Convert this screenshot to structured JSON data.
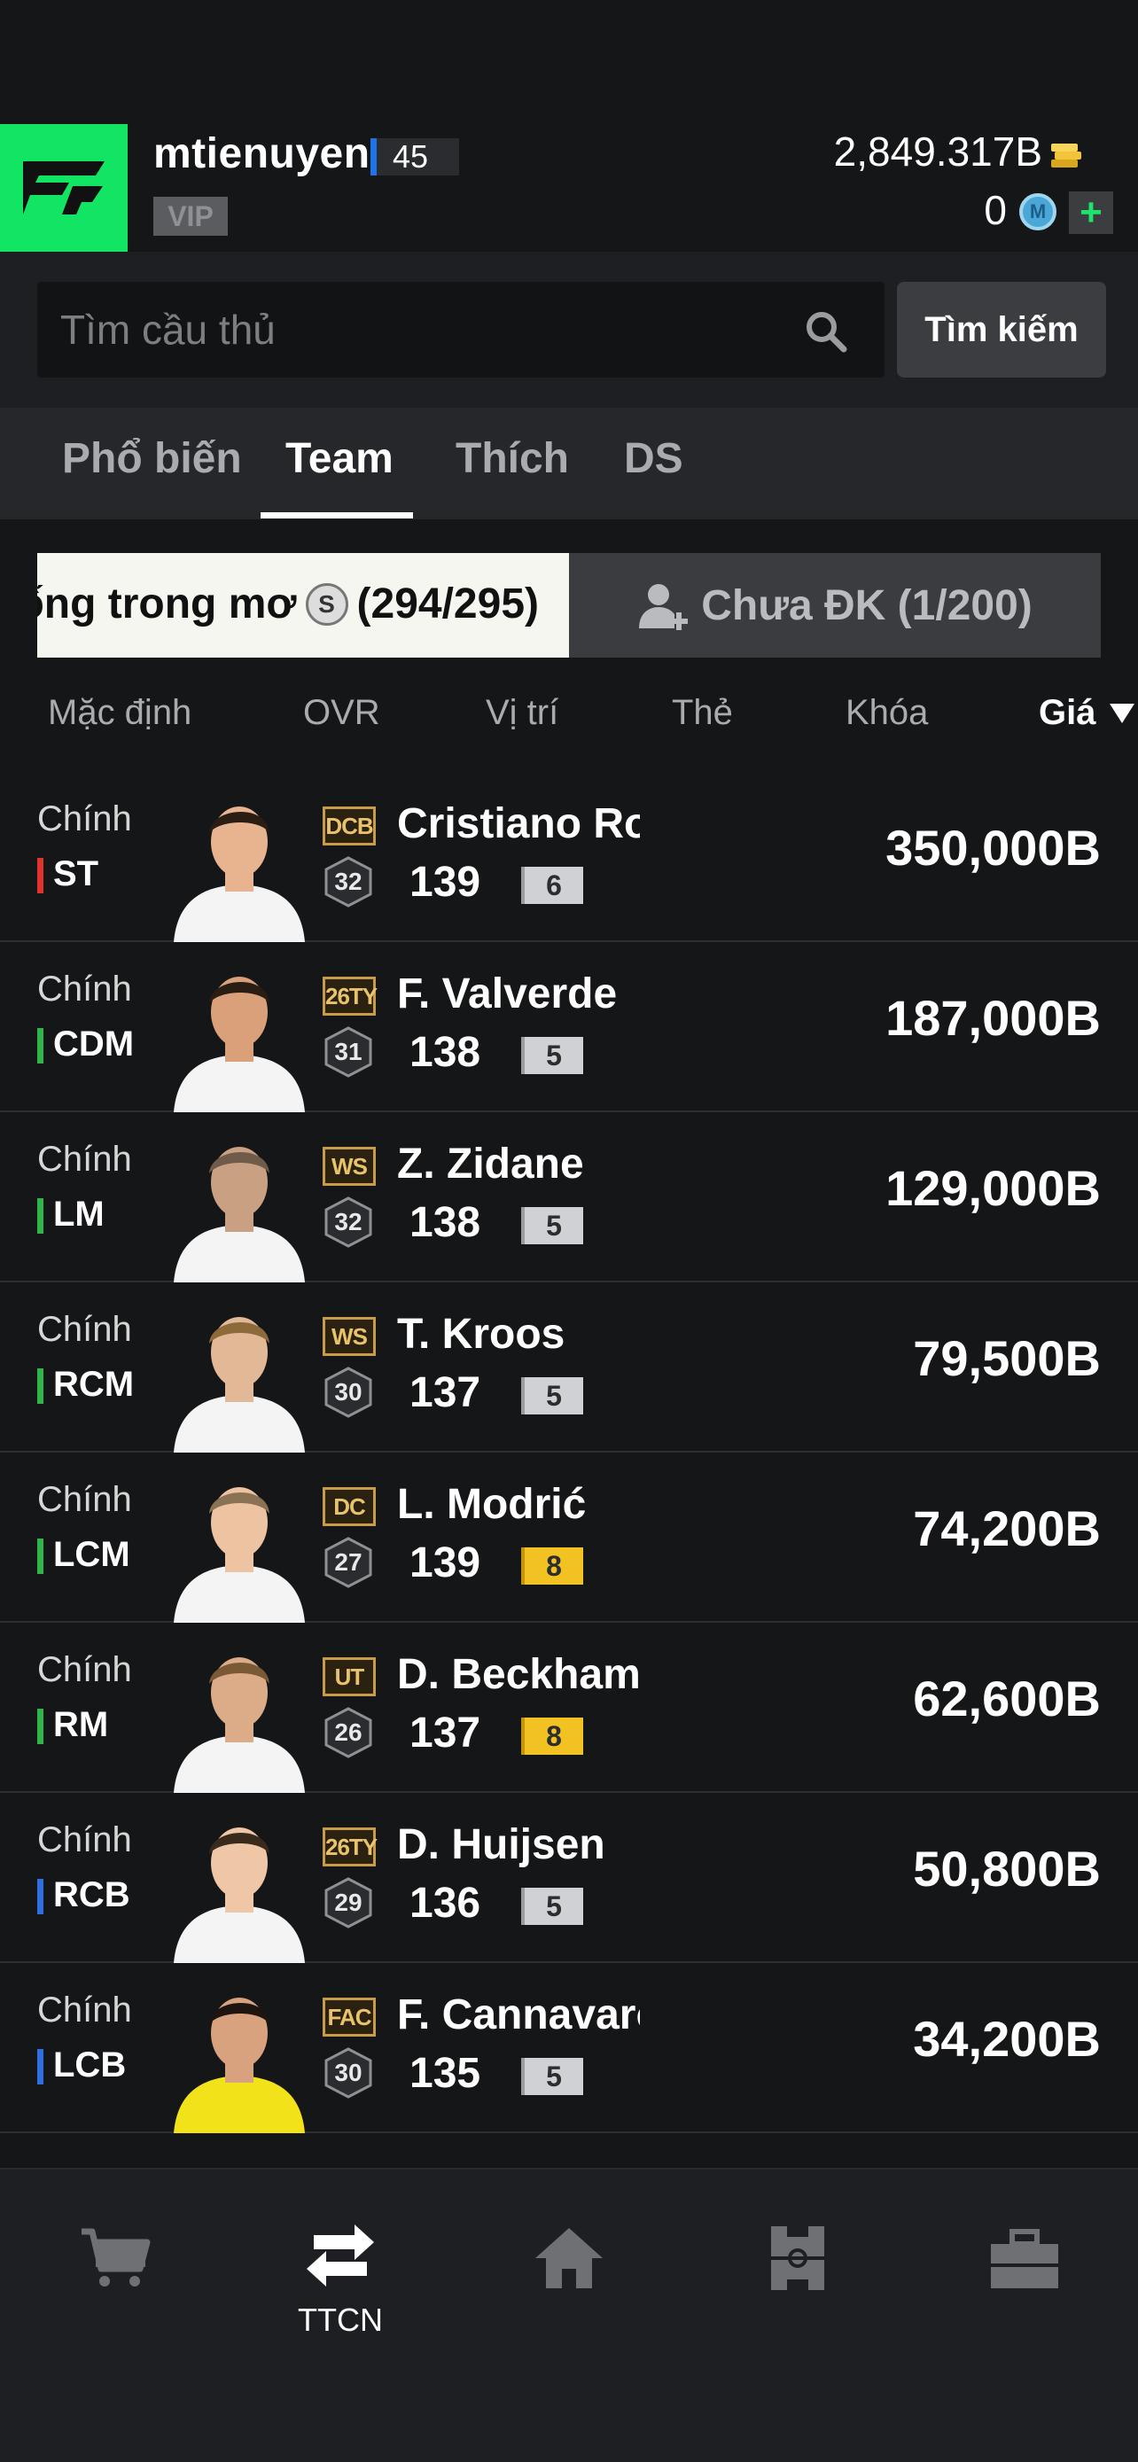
{
  "header": {
    "username": "mtienuyen",
    "level": "45",
    "vip_label": "VIP",
    "coins": "2,849.317B",
    "m_points": "0",
    "m_icon_label": "M",
    "plus_label": "+",
    "colors": {
      "brand": "#12e464",
      "level_bar": "#1e73e8"
    }
  },
  "search": {
    "placeholder": "Tìm cầu thủ",
    "button_label": "Tìm kiếm"
  },
  "tabs": [
    {
      "label": "Phổ biến"
    },
    {
      "label": "Team"
    },
    {
      "label": "Thích"
    },
    {
      "label": "DS"
    }
  ],
  "active_tab": "Team",
  "filter": {
    "left_text": "ống trong mơ",
    "left_badge": "S",
    "left_count": "(294/295)",
    "right_label": "Chưa ĐK (1/200)"
  },
  "sort": {
    "items": [
      {
        "label": "Mặc định"
      },
      {
        "label": "OVR"
      },
      {
        "label": "Vị trí"
      },
      {
        "label": "Thẻ"
      },
      {
        "label": "Khóa"
      },
      {
        "label": "Giá"
      }
    ],
    "active": "Giá"
  },
  "players": [
    {
      "status": "Chính",
      "position": "ST",
      "pos_color": "#e0332d",
      "card": "DCB",
      "team_score": "32",
      "name": "Cristiano Ronaldo",
      "ovr": "139",
      "grade": "6",
      "grade_gold": false,
      "price": "350,000B"
    },
    {
      "status": "Chính",
      "position": "CDM",
      "pos_color": "#2fb54a",
      "card": "26TY",
      "team_score": "31",
      "name": "F. Valverde",
      "ovr": "138",
      "grade": "5",
      "grade_gold": false,
      "price": "187,000B"
    },
    {
      "status": "Chính",
      "position": "LM",
      "pos_color": "#2fb54a",
      "card": "WS",
      "team_score": "32",
      "name": "Z. Zidane",
      "ovr": "138",
      "grade": "5",
      "grade_gold": false,
      "price": "129,000B"
    },
    {
      "status": "Chính",
      "position": "RCM",
      "pos_color": "#2fb54a",
      "card": "WS",
      "team_score": "30",
      "name": "T. Kroos",
      "ovr": "137",
      "grade": "5",
      "grade_gold": false,
      "price": "79,500B"
    },
    {
      "status": "Chính",
      "position": "LCM",
      "pos_color": "#2fb54a",
      "card": "DC",
      "team_score": "27",
      "name": "L. Modrić",
      "ovr": "139",
      "grade": "8",
      "grade_gold": true,
      "price": "74,200B"
    },
    {
      "status": "Chính",
      "position": "RM",
      "pos_color": "#2fb54a",
      "card": "UT",
      "team_score": "26",
      "name": "D. Beckham",
      "ovr": "137",
      "grade": "8",
      "grade_gold": true,
      "price": "62,600B"
    },
    {
      "status": "Chính",
      "position": "RCB",
      "pos_color": "#2f6fe0",
      "card": "26TY",
      "team_score": "29",
      "name": "D. Huijsen",
      "ovr": "136",
      "grade": "5",
      "grade_gold": false,
      "price": "50,800B"
    },
    {
      "status": "Chính",
      "position": "LCB",
      "pos_color": "#2f6fe0",
      "card": "FAC",
      "team_score": "30",
      "name": "F. Cannavaro",
      "ovr": "135",
      "grade": "5",
      "grade_gold": false,
      "price": "34,200B"
    }
  ],
  "bottom_nav": [
    {
      "icon": "cart-icon",
      "label": ""
    },
    {
      "icon": "transfer-icon",
      "label": "TTCN"
    },
    {
      "icon": "home-icon",
      "label": ""
    },
    {
      "icon": "field-icon",
      "label": ""
    },
    {
      "icon": "bag-icon",
      "label": ""
    }
  ]
}
